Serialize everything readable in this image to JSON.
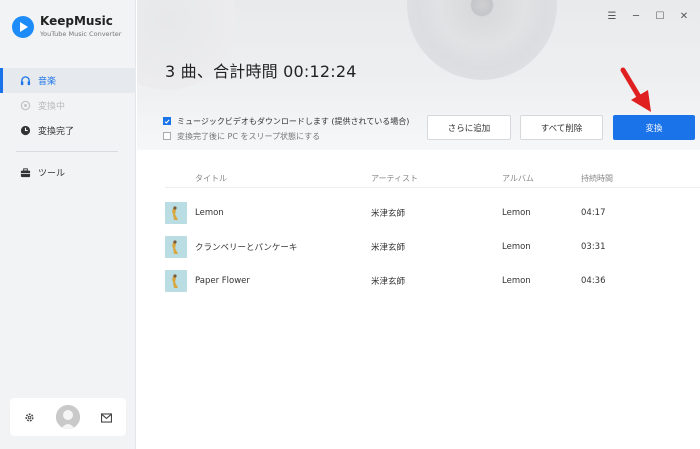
{
  "app": {
    "name": "KeepMusic",
    "subtitle": "YouTube Music Converter"
  },
  "sidebar": {
    "items": [
      {
        "label": "音楽",
        "icon": "headphones-icon",
        "state": "active"
      },
      {
        "label": "変換中",
        "icon": "converting-icon",
        "state": "disabled"
      },
      {
        "label": "変換完了",
        "icon": "clock-icon",
        "state": "normal"
      }
    ],
    "tools_label": "ツール",
    "bottom": {
      "settings_icon": "gear-icon",
      "avatar_icon": "avatar-icon",
      "mail_icon": "mail-icon"
    }
  },
  "window": {
    "menu": "☰",
    "minimize": "─",
    "maximize": "☐",
    "close": "✕"
  },
  "main": {
    "title": "3 曲、合計時間 00:12:24",
    "options": [
      {
        "label": "ミュージックビデオもダウンロードします (提供されている場合)",
        "checked": true
      },
      {
        "label": "変換完了後に PC をスリープ状態にする",
        "checked": false
      }
    ],
    "buttons": {
      "add": "さらに追加",
      "clear": "すべて削除",
      "convert": "変換"
    }
  },
  "table": {
    "headers": {
      "title": "タイトル",
      "artist": "アーティスト",
      "album": "アルバム",
      "duration": "持続時間"
    },
    "rows": [
      {
        "title": "Lemon",
        "artist": "米津玄師",
        "album": "Lemon",
        "duration": "04:17"
      },
      {
        "title": "クランベリーとパンケーキ",
        "artist": "米津玄師",
        "album": "Lemon",
        "duration": "03:31"
      },
      {
        "title": "Paper Flower",
        "artist": "米津玄師",
        "album": "Lemon",
        "duration": "04:36"
      }
    ]
  },
  "colors": {
    "accent": "#1a73e8",
    "sidebar_bg": "#f2f3f5",
    "arrow": "#e02020"
  }
}
